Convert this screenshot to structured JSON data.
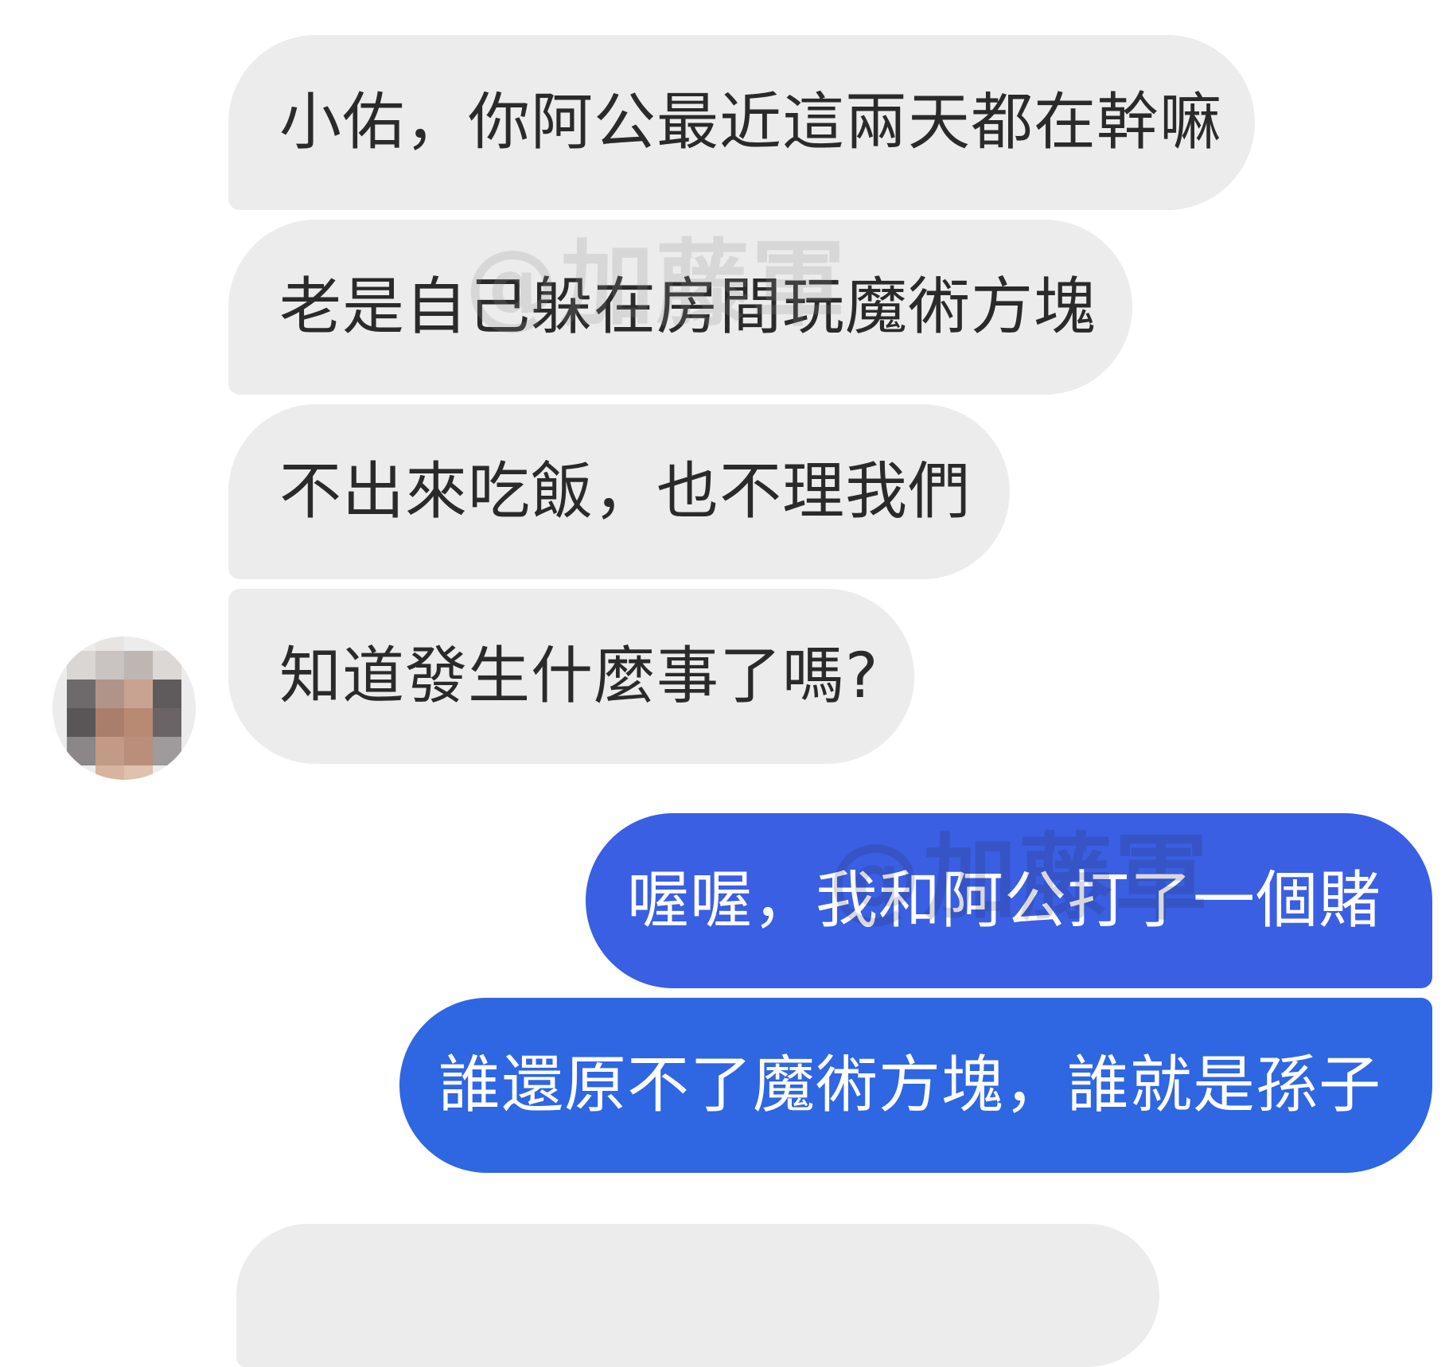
{
  "messages": {
    "incoming": [
      "小佑，你阿公最近這兩天都在幹嘛",
      "老是自己躲在房間玩魔術方塊",
      "不出來吃飯，也不理我們",
      "知道發生什麼事了嗎?"
    ],
    "outgoing": [
      "喔喔，我和阿公打了一個賭",
      "誰還原不了魔術方塊，誰就是孫子"
    ]
  },
  "watermark": "@加藤軍",
  "colors": {
    "incoming_bubble": "#ececec",
    "outgoing_bubble": "#3a5fe3",
    "outgoing_bubble_2": "#2f66e2",
    "incoming_text": "#2a2a2a",
    "outgoing_text": "#ffffff"
  }
}
